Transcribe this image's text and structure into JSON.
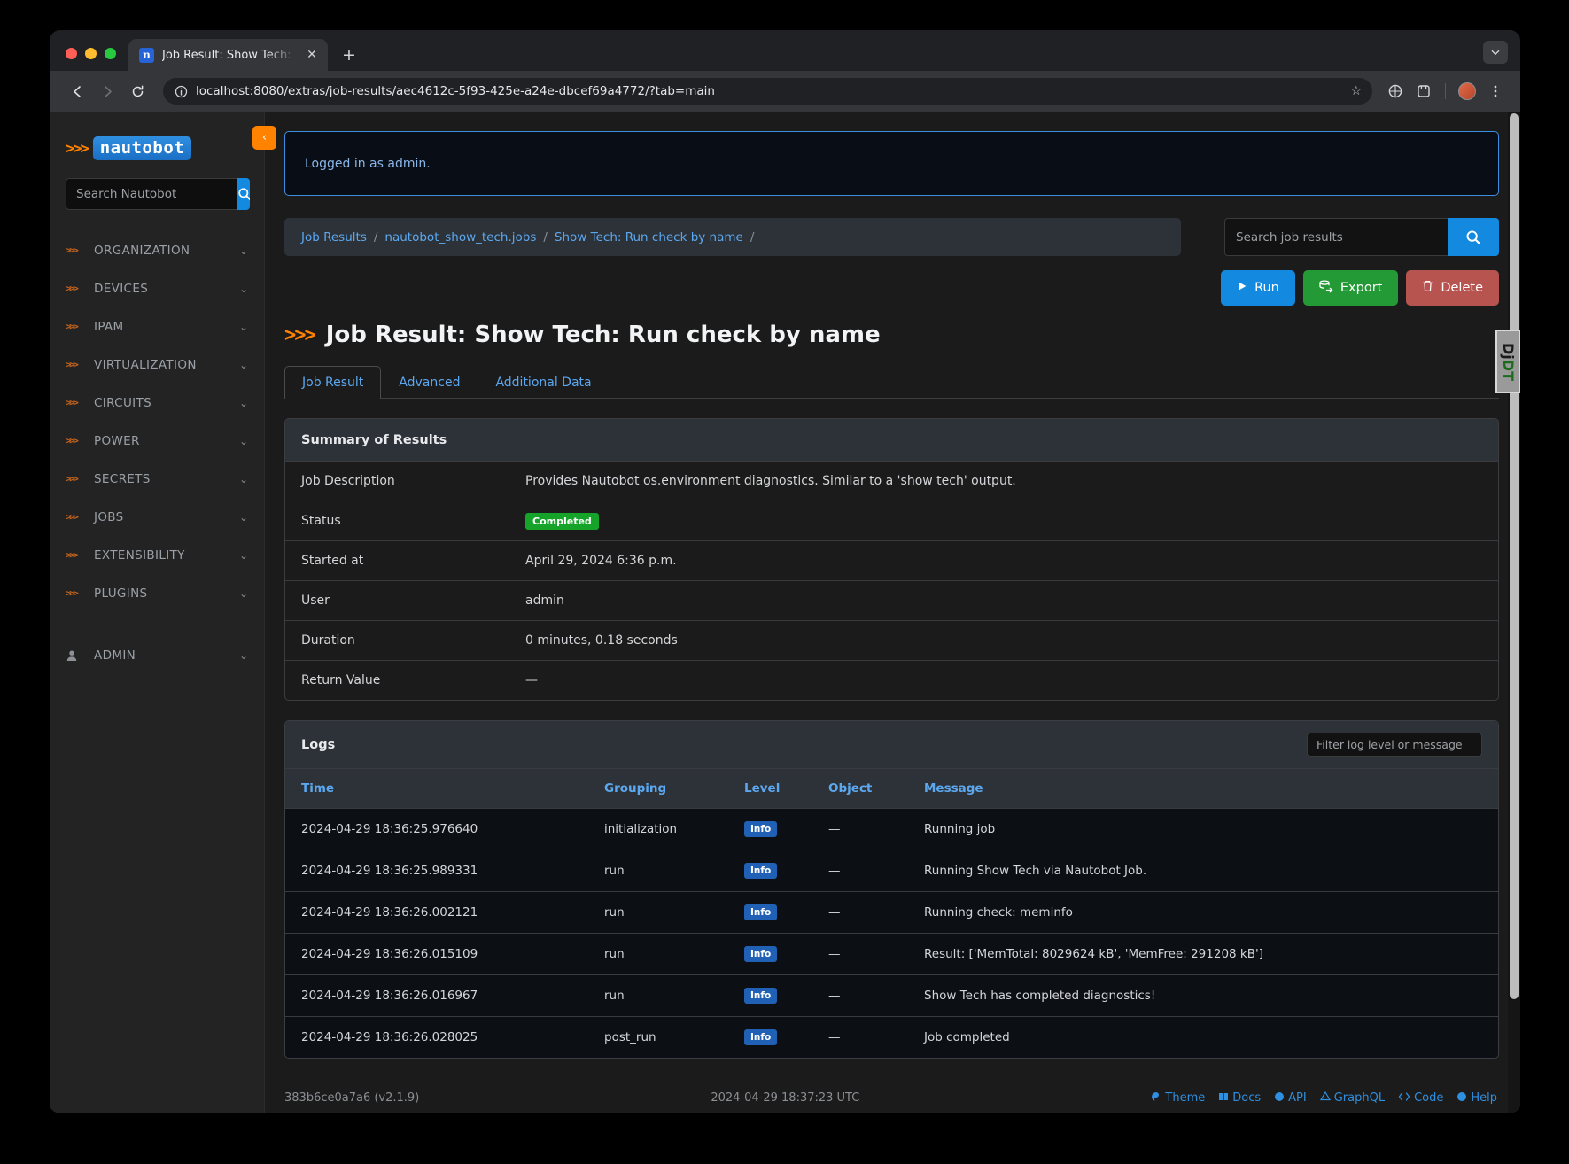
{
  "browser": {
    "tab": {
      "title": "Job Result: Show Tech: Run c",
      "favicon_letter": "n",
      "close_glyph": "✕"
    },
    "new_tab_glyph": "+",
    "url": "localhost:8080/extras/job-results/aec4612c-5f93-425e-a24e-dbcef69a4772/?tab=main",
    "back_glyph": "←",
    "forward_glyph": "→",
    "reload_glyph": "⟳",
    "star_glyph": "☆"
  },
  "sidebar": {
    "brand": "nautobot",
    "chevrons": ">>>",
    "search": {
      "placeholder": "Search Nautobot",
      "value": ""
    },
    "collapse_glyph": "‹",
    "items": [
      {
        "label": "ORGANIZATION",
        "icon": "chevrons-icon"
      },
      {
        "label": "DEVICES",
        "icon": "chevrons-icon"
      },
      {
        "label": "IPAM",
        "icon": "chevrons-icon"
      },
      {
        "label": "VIRTUALIZATION",
        "icon": "chevrons-icon"
      },
      {
        "label": "CIRCUITS",
        "icon": "chevrons-icon"
      },
      {
        "label": "POWER",
        "icon": "chevrons-icon"
      },
      {
        "label": "SECRETS",
        "icon": "chevrons-icon"
      },
      {
        "label": "JOBS",
        "icon": "chevrons-icon"
      },
      {
        "label": "EXTENSIBILITY",
        "icon": "chevrons-icon"
      },
      {
        "label": "PLUGINS",
        "icon": "chevrons-icon"
      }
    ],
    "admin": {
      "label": "ADMIN",
      "icon": "user-icon"
    },
    "caret_glyph": "⌄"
  },
  "alert": {
    "message": "Logged in as admin."
  },
  "breadcrumb": {
    "items": [
      "Job Results",
      "nautobot_show_tech.jobs",
      "Show Tech: Run check by name"
    ],
    "separator": "/"
  },
  "job_search": {
    "placeholder": "Search job results",
    "value": ""
  },
  "actions": {
    "run": "Run",
    "export": "Export",
    "delete": "Delete"
  },
  "page": {
    "title": "Job Result: Show Tech: Run check by name"
  },
  "tabs": [
    {
      "label": "Job Result",
      "active": true
    },
    {
      "label": "Advanced",
      "active": false
    },
    {
      "label": "Additional Data",
      "active": false
    }
  ],
  "summary": {
    "heading": "Summary of Results",
    "rows": [
      {
        "key": "Job Description",
        "value": "Provides Nautobot os.environment diagnostics. Similar to a 'show tech' output."
      },
      {
        "key": "Status",
        "value": "Completed",
        "badge": true
      },
      {
        "key": "Started at",
        "value": "April 29, 2024 6:36 p.m."
      },
      {
        "key": "User",
        "value": "admin"
      },
      {
        "key": "Duration",
        "value": "0 minutes, 0.18 seconds"
      },
      {
        "key": "Return Value",
        "value": "—"
      }
    ]
  },
  "logs": {
    "heading": "Logs",
    "filter": {
      "placeholder": "Filter log level or message",
      "value": ""
    },
    "columns": [
      "Time",
      "Grouping",
      "Level",
      "Object",
      "Message"
    ],
    "rows": [
      {
        "time": "2024-04-29 18:36:25.976640",
        "grouping": "initialization",
        "level": "Info",
        "object": "—",
        "message": "Running job"
      },
      {
        "time": "2024-04-29 18:36:25.989331",
        "grouping": "run",
        "level": "Info",
        "object": "—",
        "message": "Running Show Tech via Nautobot Job."
      },
      {
        "time": "2024-04-29 18:36:26.002121",
        "grouping": "run",
        "level": "Info",
        "object": "—",
        "message": "Running check: meminfo"
      },
      {
        "time": "2024-04-29 18:36:26.015109",
        "grouping": "run",
        "level": "Info",
        "object": "—",
        "message": "Result: ['MemTotal: 8029624 kB', 'MemFree: 291208 kB']"
      },
      {
        "time": "2024-04-29 18:36:26.016967",
        "grouping": "run",
        "level": "Info",
        "object": "—",
        "message": "Show Tech has completed diagnostics!"
      },
      {
        "time": "2024-04-29 18:36:26.028025",
        "grouping": "post_run",
        "level": "Info",
        "object": "—",
        "message": "Job completed"
      }
    ]
  },
  "footer": {
    "version": "383b6ce0a7a6 (v2.1.9)",
    "timestamp": "2024-04-29 18:37:23 UTC",
    "links": [
      "Theme",
      "Docs",
      "API",
      "GraphQL",
      "Code",
      "Help"
    ]
  },
  "djdt": {
    "prefix": "Dj",
    "suffix": "DT"
  },
  "colors": {
    "accent_blue": "#1389e0",
    "brand_orange": "#ff8200",
    "success_green": "#16a329",
    "danger_red": "#b85450"
  }
}
